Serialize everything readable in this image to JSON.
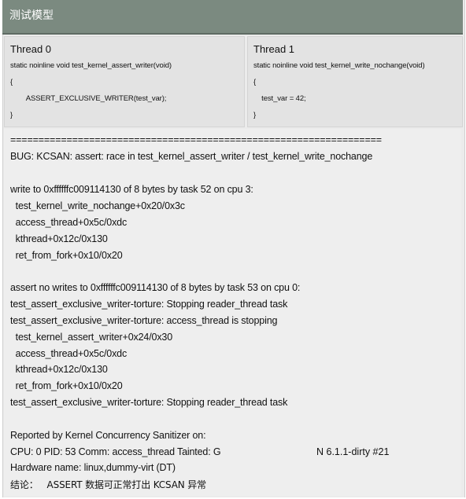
{
  "header": {
    "title": "测试模型"
  },
  "thread0": {
    "name": "Thread 0",
    "code": [
      "static noinline void test_kernel_assert_writer(void)",
      "{",
      "        ASSERT_EXCLUSIVE_WRITER(test_var);",
      "}"
    ]
  },
  "thread1": {
    "name": "Thread 1",
    "code": [
      "static noinline void test_kernel_write_nochange(void)",
      "{",
      "    test_var = 42;",
      "}"
    ]
  },
  "log": {
    "lines": [
      "==================================================================",
      "BUG: KCSAN: assert: race in test_kernel_assert_writer / test_kernel_write_nochange",
      "",
      "write to 0xffffffc009114130 of 8 bytes by task 52 on cpu 3:",
      "  test_kernel_write_nochange+0x20/0x3c",
      "  access_thread+0x5c/0xdc",
      "  kthread+0x12c/0x130",
      "  ret_from_fork+0x10/0x20",
      "",
      "assert no writes to 0xffffffc009114130 of 8 bytes by task 53 on cpu 0:",
      "test_assert_exclusive_writer-torture: Stopping reader_thread task",
      "test_assert_exclusive_writer-torture: access_thread is stopping",
      "  test_kernel_assert_writer+0x24/0x30",
      "  access_thread+0x5c/0xdc",
      "  kthread+0x12c/0x130",
      "  ret_from_fork+0x10/0x20",
      "test_assert_exclusive_writer-torture: Stopping reader_thread task",
      "",
      "Reported by Kernel Concurrency Sanitizer on:",
      "CPU: 0 PID: 53 Comm: access_thread Tainted: G",
      "Hardware name: linux,dummy-virt (DT)",
      "结论：   ASSERT 数据可正常打出 KCSAN 异常"
    ],
    "version": "N 6.1.1-dirty #21"
  }
}
